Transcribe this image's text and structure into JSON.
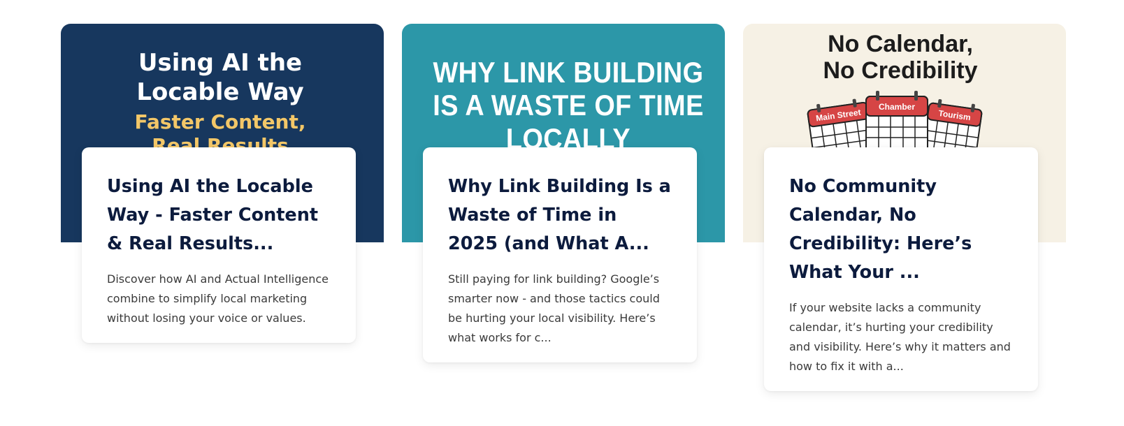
{
  "cards": [
    {
      "image": {
        "lines": [
          "Using AI the",
          "Locable Way",
          "Faster Content,",
          "Real Results"
        ],
        "background": "#17375e",
        "accent": "#f3c768"
      },
      "title": "Using AI the Locable Way - Faster Content & Real Results...",
      "excerpt": "Discover how AI and Actual Intelligence combine to simplify local marketing without losing your voice or values."
    },
    {
      "image": {
        "lines": [
          "WHY LINK BUILDING",
          "IS A WASTE OF TIME",
          "LOCALLY"
        ],
        "background": "#2c97a8"
      },
      "title": "Why Link Building Is a Waste of Time in 2025 (and What A...",
      "excerpt": "Still paying for link building? Google’s smarter now - and those tactics could be hurting your local visibility. Here’s what works for c..."
    },
    {
      "image": {
        "lines": [
          "No Calendar,",
          "No Credibility"
        ],
        "calendar_labels": [
          "Main Street",
          "Chamber",
          "Tourism"
        ],
        "background": "#f6f1e5",
        "calendar_color": "#d64545"
      },
      "title": "No Community Calendar, No Credibility: Here’s What Your ...",
      "excerpt": "If your website lacks a community calendar, it’s hurting your credibility and visibility. Here’s why it matters and how to fix it with a..."
    }
  ]
}
